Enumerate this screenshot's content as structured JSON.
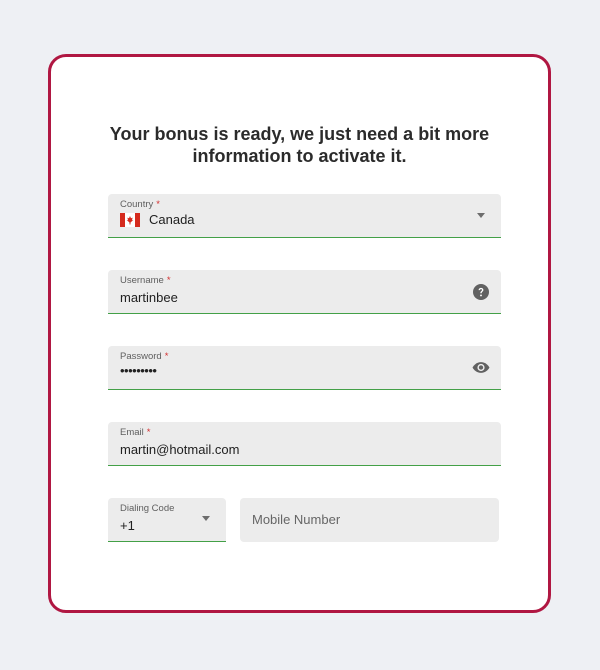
{
  "heading": {
    "line1": "Your bonus is ready, we just need a bit more",
    "line2": "information to activate it."
  },
  "country": {
    "label": "Country",
    "required_mark": "*",
    "value": "Canada",
    "flag_icon": "canada-flag-icon",
    "dropdown_icon": "chevron-down-icon"
  },
  "username": {
    "label": "Username",
    "required_mark": "*",
    "value": "martinbee",
    "help_icon": "question-circle-icon"
  },
  "password": {
    "label": "Password",
    "required_mark": "*",
    "value": "•••••••••",
    "visibility_icon": "eye-icon"
  },
  "email": {
    "label": "Email",
    "required_mark": "*",
    "value": "martin@hotmail.com"
  },
  "dialing_code": {
    "label": "Dialing Code",
    "value": "+1",
    "dropdown_icon": "chevron-down-icon"
  },
  "mobile": {
    "placeholder": "Mobile Number",
    "value": ""
  },
  "colors": {
    "accent_border": "#b01742",
    "valid_underline": "#43a047",
    "required": "#d32f2f",
    "field_bg": "#ececec",
    "page_bg": "#eef0f4"
  }
}
